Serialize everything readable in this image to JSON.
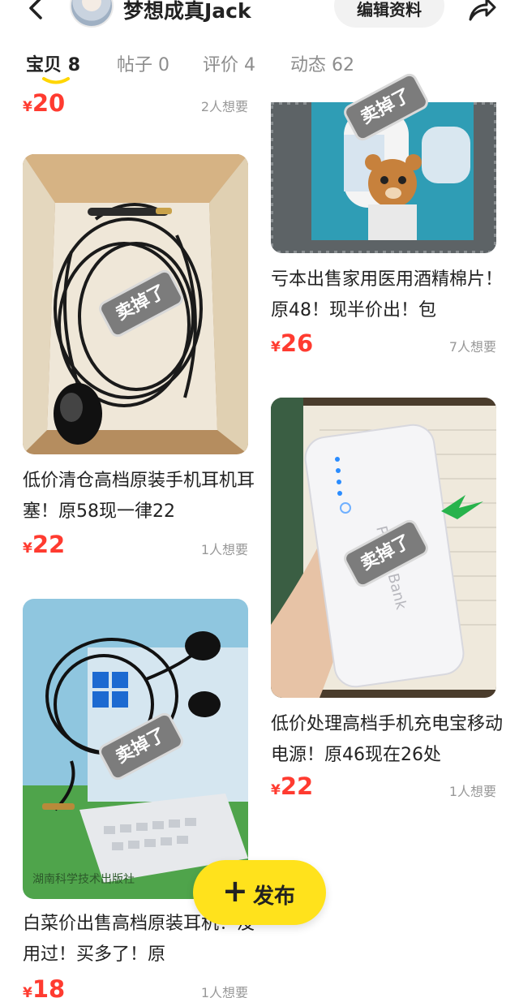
{
  "header": {
    "user_name": "梦想成真Jack",
    "edit_label": "编辑资料"
  },
  "tabs": [
    {
      "label": "宝贝",
      "count": "8"
    },
    {
      "label": "帖子",
      "count": "0"
    },
    {
      "label": "评价",
      "count": "4"
    },
    {
      "label": "动态",
      "count": "62"
    }
  ],
  "colors": {
    "accent": "#ffe21c",
    "price": "#ff3b30"
  },
  "currency": "¥",
  "sold_label": "卖掉了",
  "top_partial": {
    "price": "20",
    "wants": "2人想要"
  },
  "items": [
    {
      "title": "低价清仓高档原装手机耳机耳塞！原58现一律22",
      "price": "22",
      "wants": "1人想要"
    },
    {
      "title": "亏本出售家用医用酒精棉片！原48！现半价出！包",
      "price": "26",
      "wants": "7人想要"
    },
    {
      "title": "低价处理高档手机充电宝移动电源！原46现在26处",
      "price": "22",
      "wants": "1人想要"
    },
    {
      "title": "白菜价出售高档原装耳机！没用过！买多了！原",
      "price": "18",
      "wants": "1人想要"
    }
  ],
  "photo_texts": {
    "brand_watermark": "湖南科学技术出版社",
    "powerbank_text": "Power Bank"
  },
  "fab": {
    "label": "发布"
  },
  "icons": [
    "back-arrow-icon",
    "share-arrow-icon",
    "plus-icon"
  ]
}
